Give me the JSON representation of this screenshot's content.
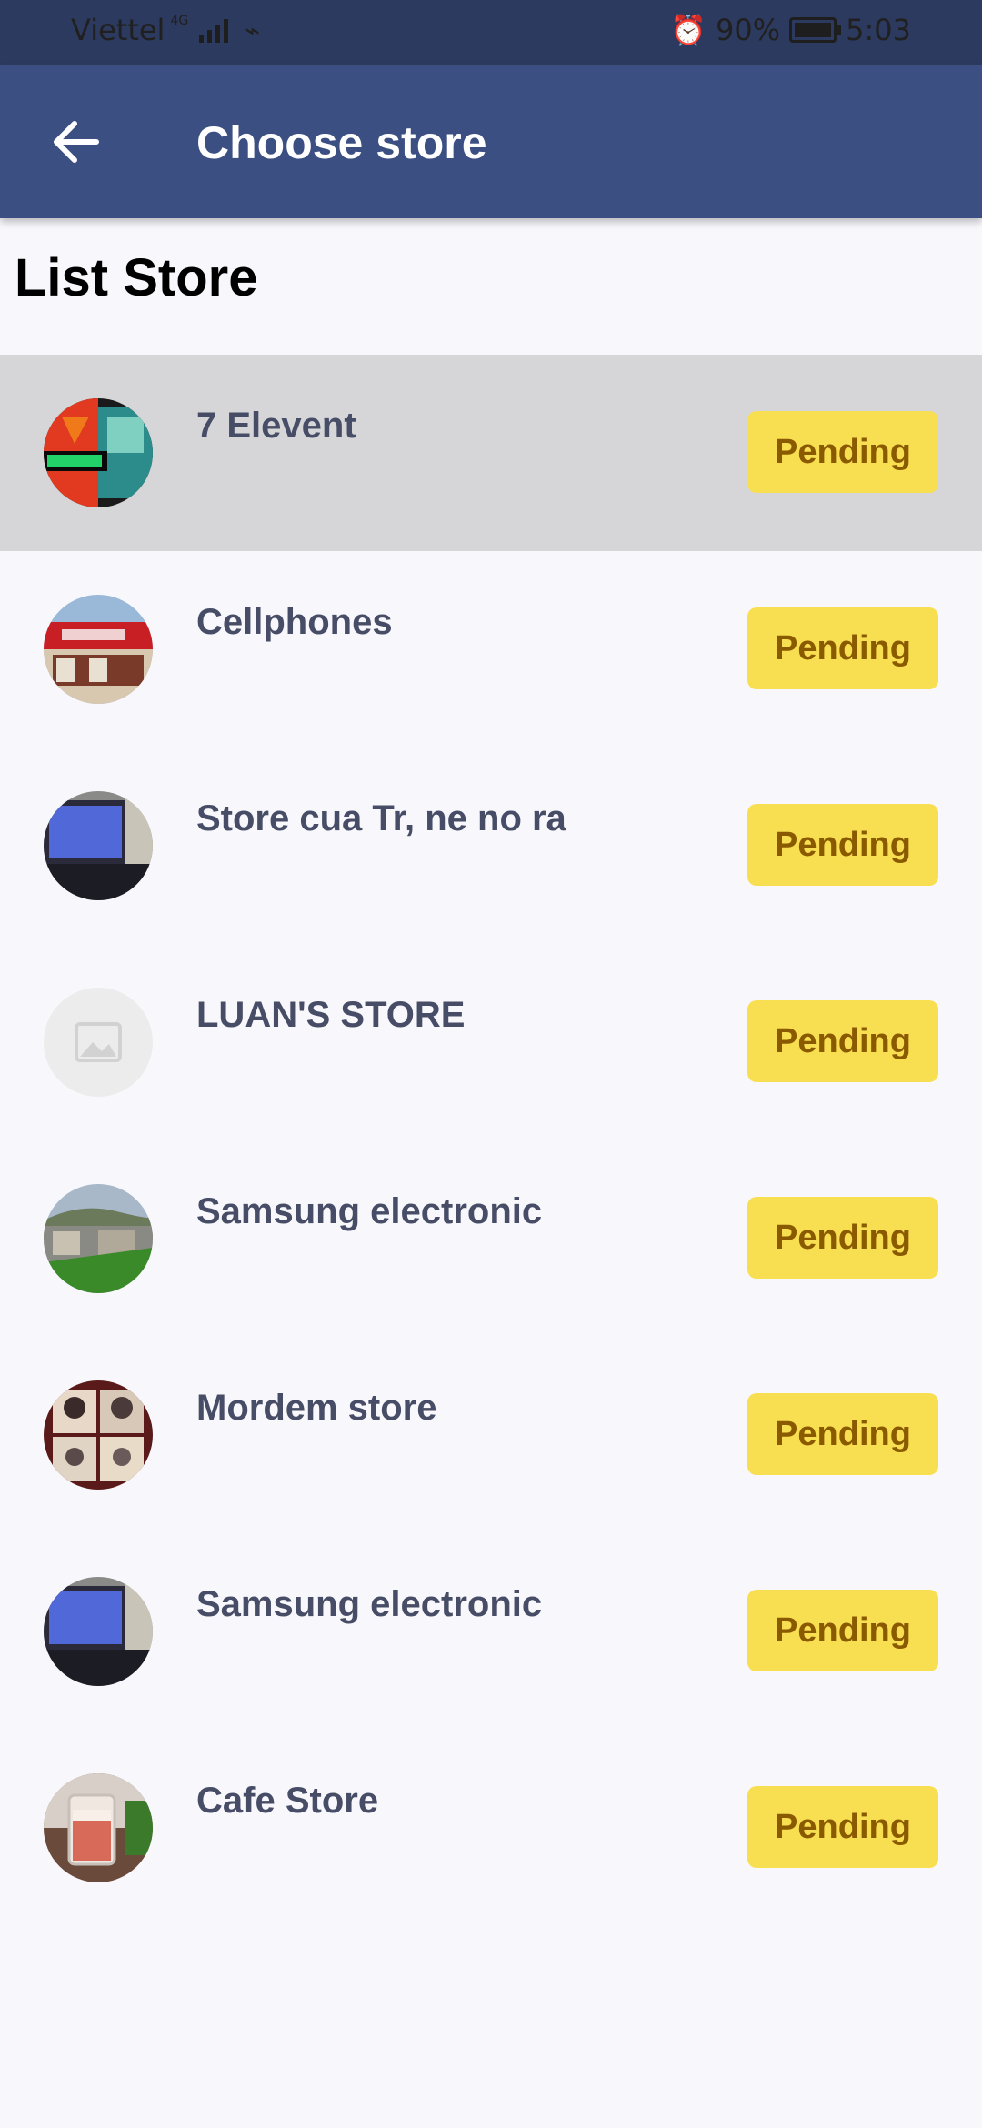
{
  "status_bar": {
    "carrier": "Viettel",
    "network_type": "4G",
    "battery": "90%",
    "time": "5:03"
  },
  "app_bar": {
    "title": "Choose store",
    "back_icon": "arrow-left-icon"
  },
  "section_title": "List Store",
  "stores": [
    {
      "name": "7 Elevent",
      "status": "Pending",
      "selected": true
    },
    {
      "name": "Cellphones",
      "status": "Pending"
    },
    {
      "name": "Store cua Tr, ne no ra",
      "status": "Pending"
    },
    {
      "name": "LUAN'S STORE",
      "status": "Pending"
    },
    {
      "name": "Samsung electronic",
      "status": "Pending"
    },
    {
      "name": "Mordem store",
      "status": "Pending"
    },
    {
      "name": "Samsung electronic",
      "status": "Pending"
    },
    {
      "name": "Cafe Store",
      "status": "Pending"
    }
  ],
  "colors": {
    "app_bar": "#3b4f82",
    "status_badge": "#f8de51",
    "status_text": "#8a5a00",
    "selected_row": "#d6d6d8"
  }
}
